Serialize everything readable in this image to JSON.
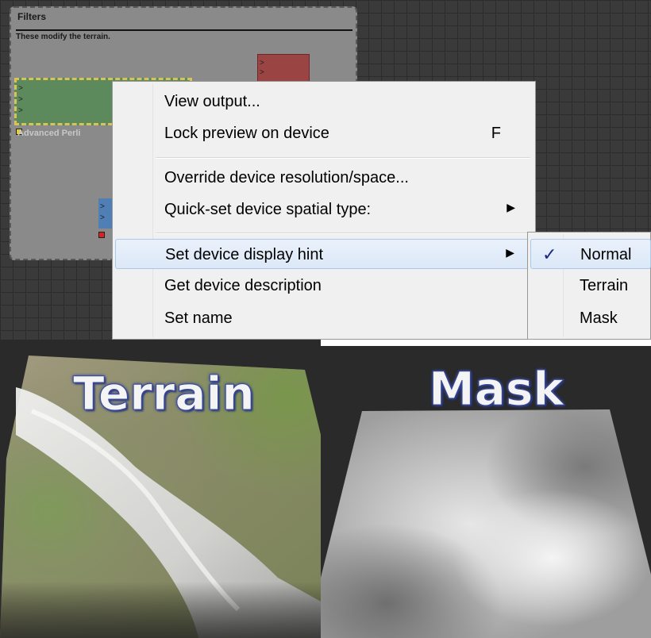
{
  "filters_group": {
    "title": "Filters",
    "description": "These modify the terrain.",
    "node_label": "Advanced Perli"
  },
  "context_menu": {
    "items": [
      {
        "label": "View output...",
        "shortcut": "",
        "submenu": false
      },
      {
        "label": "Lock preview on device",
        "shortcut": "F",
        "submenu": false
      },
      {
        "label": "Override device resolution/space...",
        "shortcut": "",
        "submenu": false
      },
      {
        "label": "Quick-set device spatial type:",
        "shortcut": "",
        "submenu": true
      },
      {
        "label": "Set device display hint",
        "shortcut": "",
        "submenu": true,
        "highlighted": true
      },
      {
        "label": "Get device description",
        "shortcut": "",
        "submenu": false
      },
      {
        "label": "Set name",
        "shortcut": "",
        "submenu": false
      }
    ],
    "submenu_arrow": "▶"
  },
  "display_hint_submenu": {
    "items": [
      {
        "label": "Normal",
        "checked": true
      },
      {
        "label": "Terrain",
        "checked": false
      },
      {
        "label": "Mask",
        "checked": false
      }
    ],
    "check_glyph": "✓"
  },
  "previews": {
    "terrain_label": "Terrain",
    "mask_label": "Mask"
  },
  "colors": {
    "menu_bg": "#f0f0f0",
    "highlight_bg": "#dce8f8",
    "label_outline": "#3a4a9a"
  }
}
